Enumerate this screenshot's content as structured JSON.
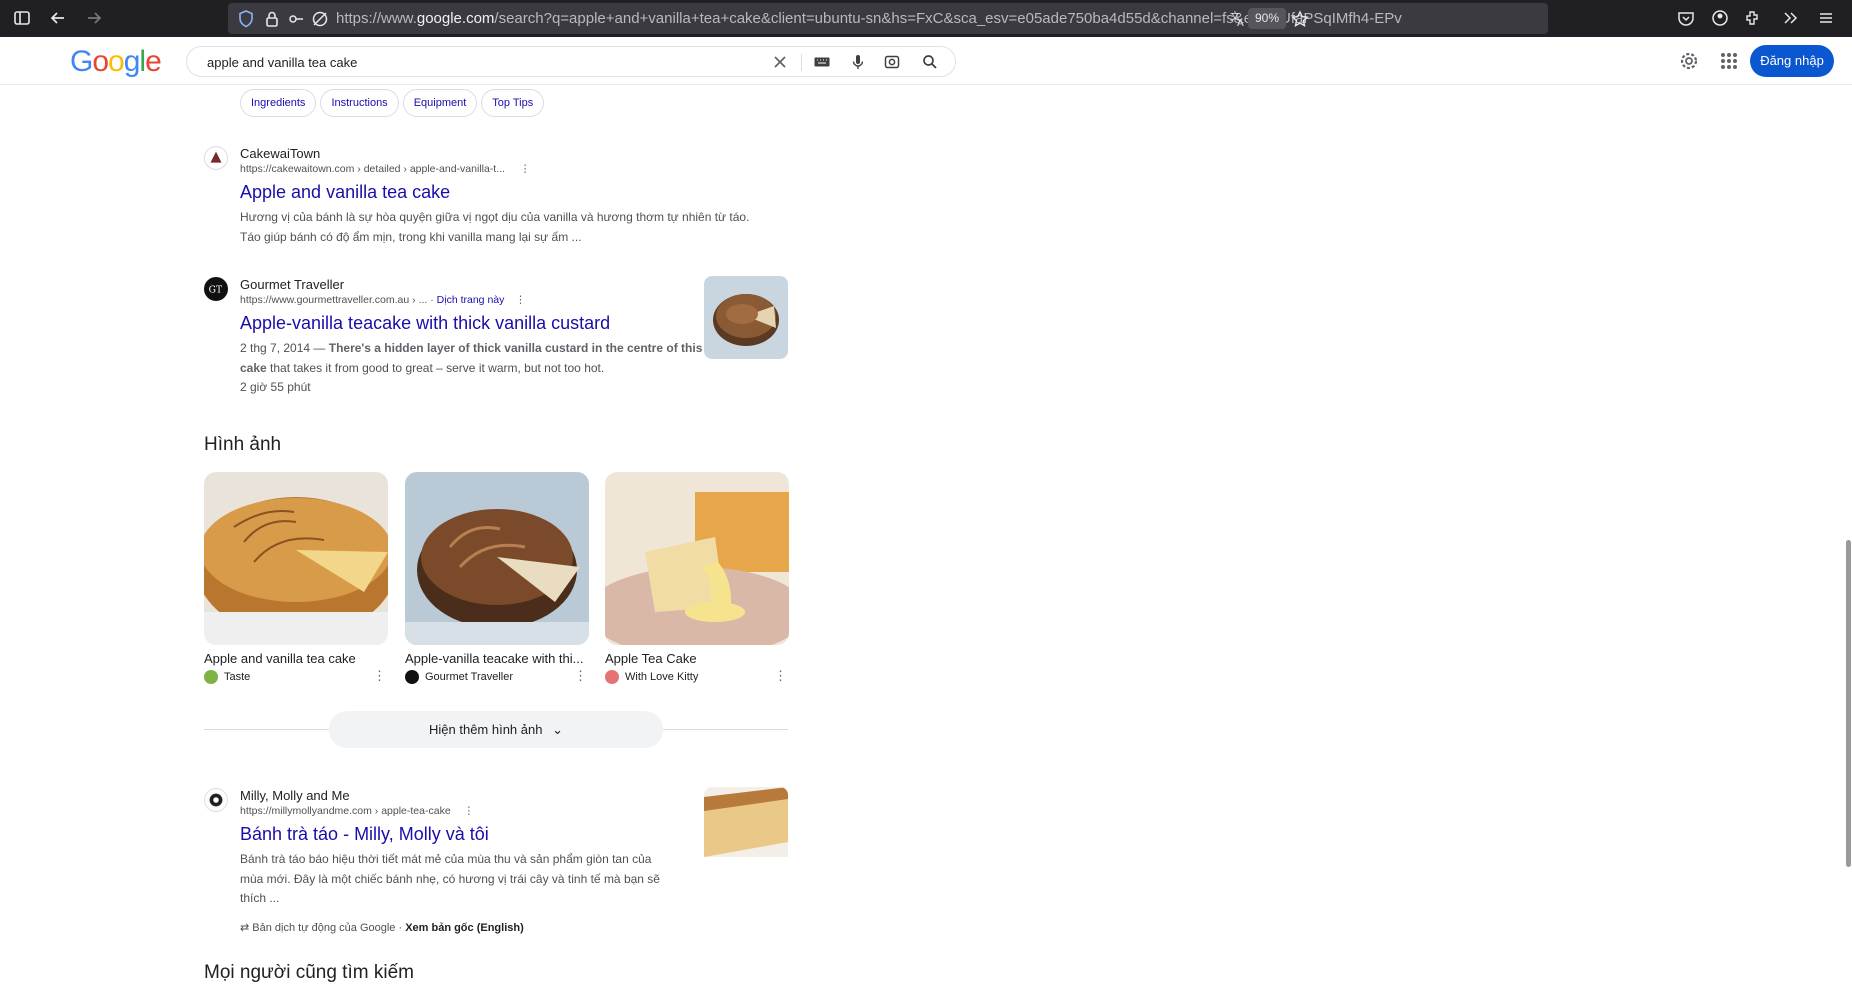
{
  "browser": {
    "url_prefix": "https://www.",
    "url_domain": "google.com",
    "url_rest": "/search?q=apple+and+vanilla+tea+cake&client=ubuntu-sn&hs=FxC&sca_esv=e05ade750ba4d55d&channel=fs&ei=yoUfaPSqIMfh4-EPv",
    "zoom": "90%"
  },
  "header": {
    "logo_letters": [
      "G",
      "o",
      "o",
      "g",
      "l",
      "e"
    ],
    "query": "apple and vanilla tea cake",
    "login_label": "Đăng nhập"
  },
  "chips": [
    "Ingredients",
    "Instructions",
    "Equipment",
    "Top Tips"
  ],
  "results": [
    {
      "site": "CakewaiTown",
      "crumb": "https://cakewaitown.com › detailed › apple-and-vanilla-t...",
      "title": "Apple and vanilla tea cake",
      "snippet_line1": "Hương vị của bánh là sự hòa quyện giữa vị ngọt dịu của vanilla và hương thơm tự nhiên từ táo.",
      "snippet_line2": "Táo giúp bánh có độ ẩm mịn, trong khi vanilla mang lại sự ấm ..."
    },
    {
      "site": "Gourmet Traveller",
      "crumb": "https://www.gourmettraveller.com.au › ...",
      "translate_link": "Dịch trang này",
      "title": "Apple-vanilla teacake with thick vanilla custard",
      "date": "2 thg 7, 2014 — ",
      "snippet_bold1": "There's a hidden layer of thick vanilla custard in the centre",
      "snippet_bold2": "of this cake",
      "snippet_rest": " that takes it from good to great – serve it warm, but not too hot.",
      "duration": "2 giờ 55 phút"
    },
    {
      "site": "Milly, Molly and Me",
      "crumb": "https://millymollyandme.com › apple-tea-cake",
      "title": "Bánh trà táo - Milly, Molly và tôi",
      "snippet_line1": "Bánh trà táo báo hiệu thời tiết mát mẻ của mùa thu và sản phẩm giòn tan của",
      "snippet_line2": "mùa mới. Đây là một chiếc bánh nhẹ, có hương vị trái cây và tinh tế mà bạn sẽ",
      "snippet_line3": "thích ..."
    }
  ],
  "images_heading": "Hình ảnh",
  "images": [
    {
      "caption": "Apple and vanilla tea cake",
      "source": "Taste",
      "dot_color": "#7cb342"
    },
    {
      "caption": "Apple-vanilla teacake with thi...",
      "source": "Gourmet Traveller",
      "dot_color": "#111111"
    },
    {
      "caption": "Apple Tea Cake",
      "source": "With Love Kitty",
      "dot_color": "#e57373"
    }
  ],
  "show_more_images": "Hiện thêm hình ảnh",
  "translated_note": "Bản dịch tự động của Google · ",
  "view_original": "Xem bản gốc (English)",
  "people_also_search": "Mọi người cũng tìm kiếm"
}
